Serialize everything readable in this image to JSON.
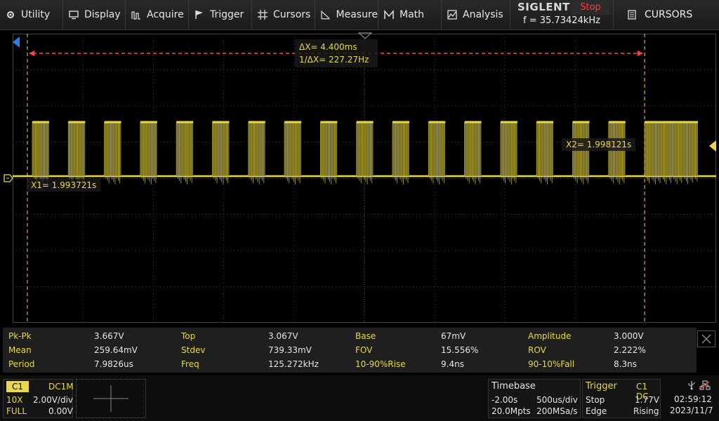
{
  "menu": {
    "items": [
      {
        "label": "Utility",
        "icon": "gear-icon"
      },
      {
        "label": "Display",
        "icon": "monitor-icon"
      },
      {
        "label": "Acquire",
        "icon": "acquire-icon"
      },
      {
        "label": "Trigger",
        "icon": "flag-icon"
      },
      {
        "label": "Cursors",
        "icon": "cursor-icon"
      },
      {
        "label": "Measure",
        "icon": "measure-icon"
      },
      {
        "label": "Math",
        "icon": "math-icon"
      },
      {
        "label": "Analysis",
        "icon": "analysis-icon"
      }
    ]
  },
  "brand": {
    "name": "SIGLENT",
    "run_state": "Stop",
    "frequency": "f = 35.73424kHz"
  },
  "panel": {
    "title": "CURSORS",
    "icon": "document-icon"
  },
  "cursors": {
    "delta_x": "ΔX= 4.400ms",
    "inv_delta_x": "1/ΔX= 227.27Hz",
    "x1": "X1= 1.993721s",
    "x2": "X2= 1.998121s"
  },
  "measurements": [
    [
      {
        "label": "Pk-Pk",
        "value": "3.667V"
      },
      {
        "label": "Top",
        "value": "3.067V"
      },
      {
        "label": "Base",
        "value": "67mV"
      },
      {
        "label": "Amplitude",
        "value": "3.000V"
      }
    ],
    [
      {
        "label": "Mean",
        "value": "259.64mV"
      },
      {
        "label": "Stdev",
        "value": "739.33mV"
      },
      {
        "label": "FOV",
        "value": "15.556%"
      },
      {
        "label": "ROV",
        "value": "2.222%"
      }
    ],
    [
      {
        "label": "Period",
        "value": "7.9826us"
      },
      {
        "label": "Freq",
        "value": "125.272kHz"
      },
      {
        "label": "10-90%Rise",
        "value": "9.4ns"
      },
      {
        "label": "90-10%Fall",
        "value": "8.3ns"
      }
    ]
  ],
  "channel": {
    "name": "C1",
    "coupling": "DC1M",
    "probe": "10X",
    "scale": "2.00V/div",
    "bandwidth": "FULL",
    "offset": "0.00V"
  },
  "timebase": {
    "title": "Timebase",
    "delay": "-2.00s",
    "scale": "500us/div",
    "memory": "20.0Mpts",
    "sample_rate": "200MSa/s"
  },
  "trigger": {
    "title": "Trigger",
    "source": "C1 DC",
    "mode": "Stop",
    "level": "1.77V",
    "type": "Edge",
    "slope": "Rising"
  },
  "status": {
    "time": "02:59:12",
    "date": "2023/11/7"
  },
  "colors": {
    "trace": "#e8d84a",
    "cursor": "#ff4444",
    "accent": "#e8d84a"
  }
}
